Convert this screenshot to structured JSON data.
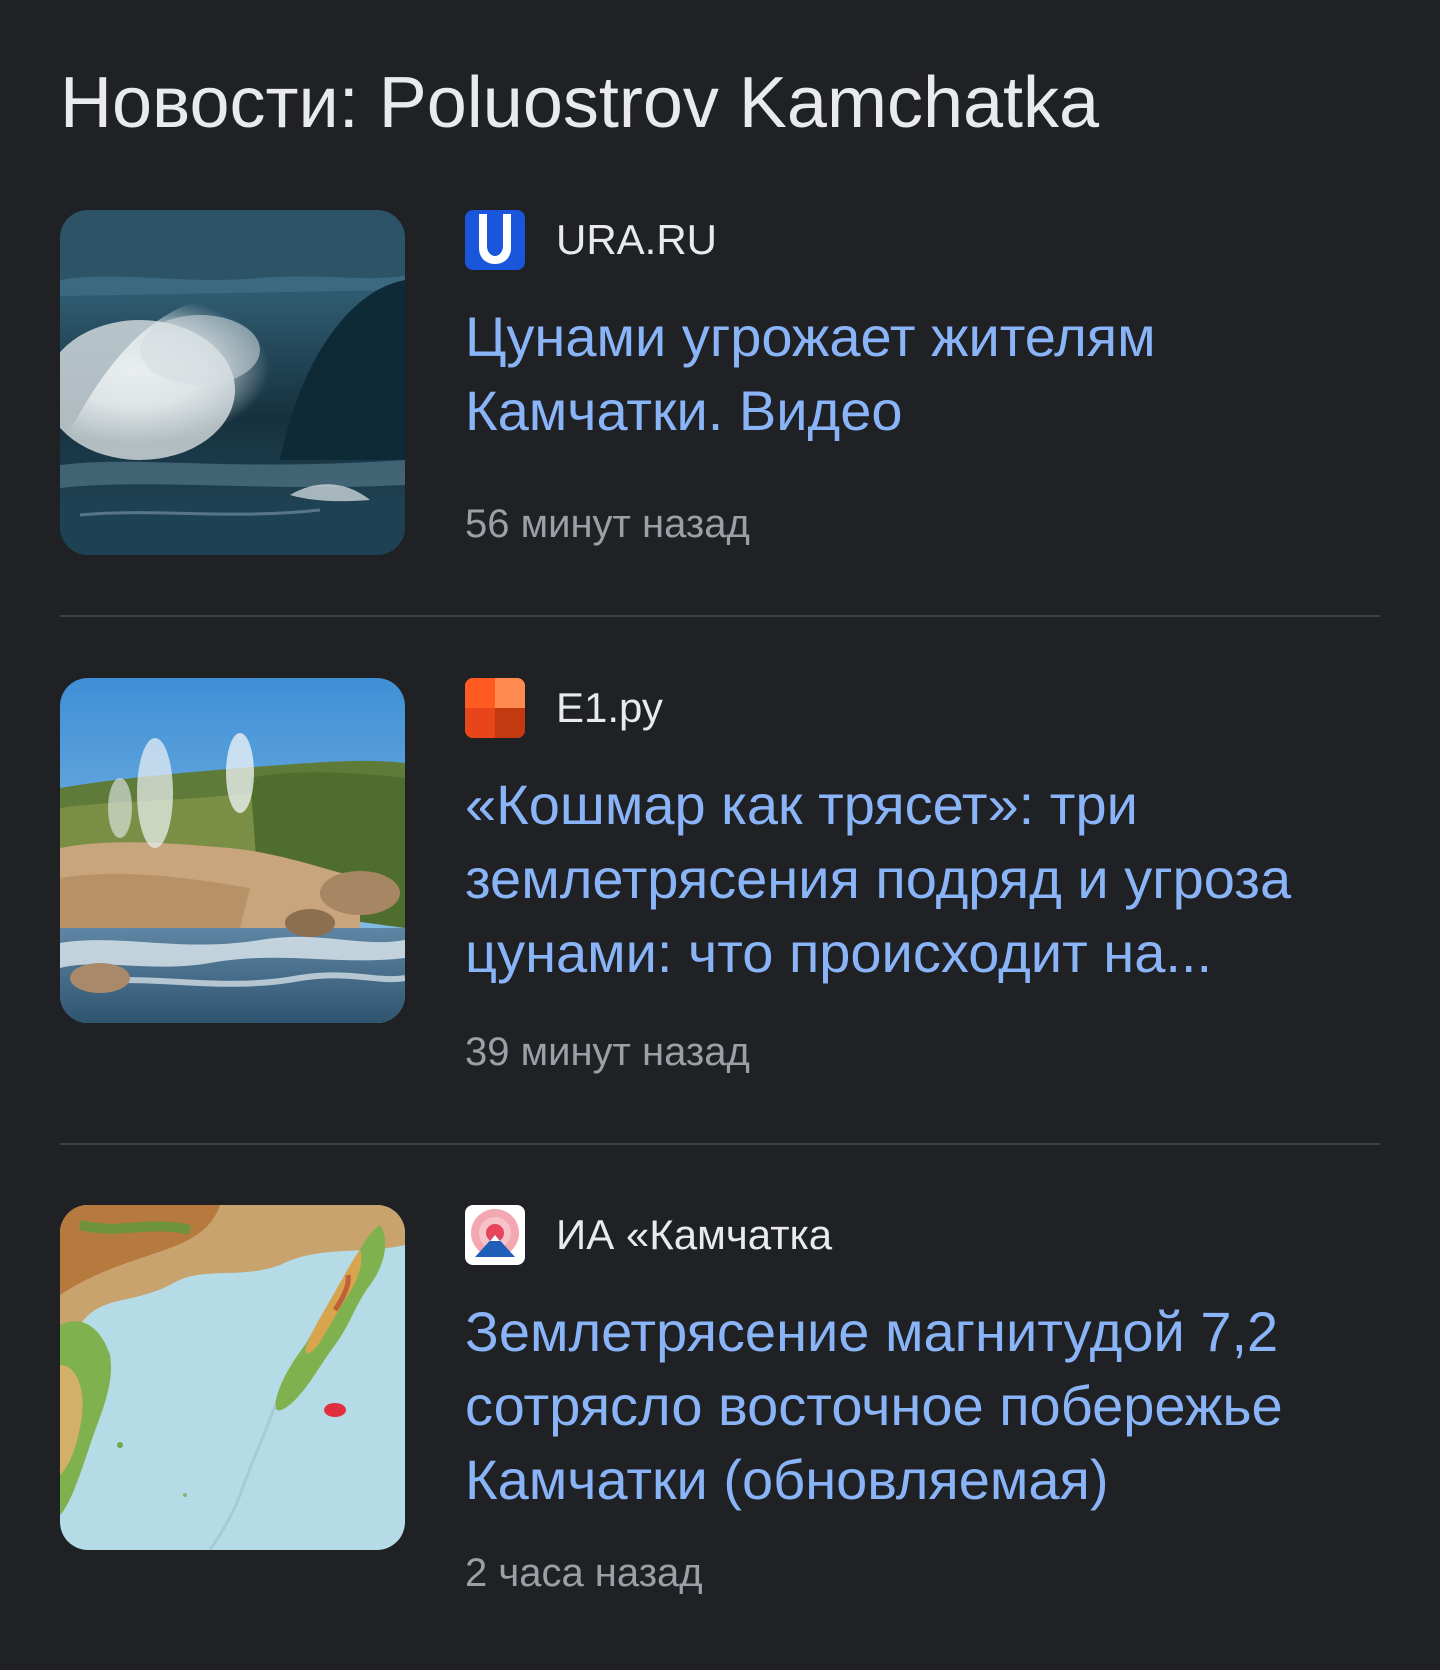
{
  "section": {
    "title": "Новости: Poluostrov Kamchatka"
  },
  "articles": [
    {
      "source": "URA.RU",
      "source_icon": "ura-ru-logo-icon",
      "headline": "Цунами угрожает жителям Камчатки. Видео",
      "time": "56 минут назад",
      "thumbnail": "ocean-wave-image"
    },
    {
      "source": "E1.ру",
      "source_icon": "e1-logo-icon",
      "headline": "«Кошмар как трясет»: три землетрясения подряд и угроза цунами: что происходит на...",
      "time": "39 минут назад",
      "thumbnail": "geyser-valley-image"
    },
    {
      "source": "ИА «Камчатка",
      "source_icon": "ia-kamchatka-logo-icon",
      "headline": "Землетрясение магнитудой 7,2 сотрясло восточное побережье Камчатки (обновляемая)",
      "time": "2 часа назад",
      "thumbnail": "kamchatka-map-image"
    }
  ],
  "colors": {
    "background": "#202124",
    "title": "#e8eaed",
    "headline": "#8ab4f8",
    "time": "#9aa0a6",
    "divider": "#3c4043"
  }
}
